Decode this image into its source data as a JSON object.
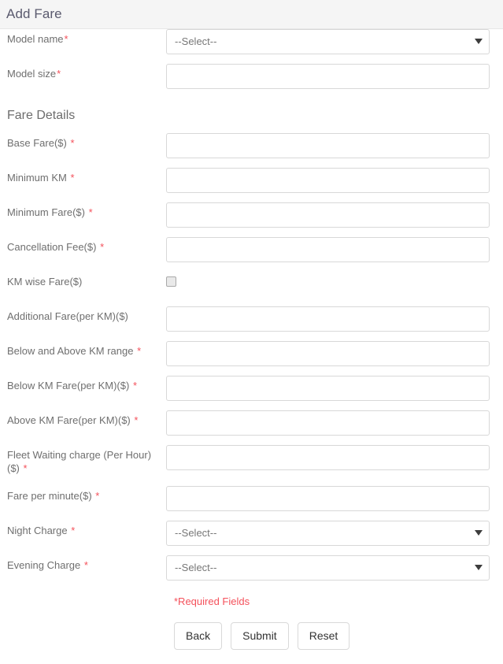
{
  "header": {
    "title": "Add Fare"
  },
  "section": {
    "fare_details_title": "Fare Details"
  },
  "fields": {
    "model_name": {
      "label": "Model name",
      "required_mark": "*",
      "type": "select",
      "value": "--Select--",
      "caret": "chevron-down-icon"
    },
    "model_size": {
      "label": "Model size",
      "required_mark": "*",
      "type": "text",
      "value": "",
      "placeholder": ""
    },
    "base_fare": {
      "label": "Base Fare($)",
      "required_mark": "*",
      "type": "text",
      "value": "",
      "placeholder": ""
    },
    "minimum_km": {
      "label": "Minimum KM",
      "required_mark": "*",
      "type": "text",
      "value": "",
      "placeholder": ""
    },
    "minimum_fare": {
      "label": "Minimum Fare($)",
      "required_mark": "*",
      "type": "text",
      "value": "",
      "placeholder": ""
    },
    "cancellation_fee": {
      "label": "Cancellation Fee($)",
      "required_mark": "*",
      "type": "text",
      "value": "",
      "placeholder": ""
    },
    "km_wise_fare": {
      "label": "KM wise Fare($)",
      "required_mark": "",
      "type": "checkbox",
      "checked": false
    },
    "additional_fare": {
      "label": "Additional Fare(per KM)($)",
      "required_mark": "",
      "type": "text",
      "value": "",
      "placeholder": ""
    },
    "below_above_km_range": {
      "label": "Below and Above KM range",
      "required_mark": "*",
      "type": "text",
      "value": "",
      "placeholder": ""
    },
    "below_km_fare": {
      "label": "Below KM Fare(per KM)($)",
      "required_mark": "*",
      "type": "text",
      "value": "",
      "placeholder": ""
    },
    "above_km_fare": {
      "label": "Above KM Fare(per KM)($)",
      "required_mark": "*",
      "type": "text",
      "value": "",
      "placeholder": ""
    },
    "fleet_waiting_charge": {
      "label": "Fleet Waiting charge (Per Hour) ($)",
      "required_mark": "*",
      "type": "text",
      "value": "",
      "placeholder": ""
    },
    "fare_per_minute": {
      "label": "Fare per minute($)",
      "required_mark": "*",
      "type": "text",
      "value": "",
      "placeholder": ""
    },
    "night_charge": {
      "label": "Night Charge",
      "required_mark": "*",
      "type": "select",
      "value": "--Select--",
      "caret": "chevron-down-icon"
    },
    "evening_charge": {
      "label": "Evening Charge",
      "required_mark": "*",
      "type": "select",
      "value": "--Select--",
      "caret": "chevron-down-icon"
    }
  },
  "notes": {
    "required_fields": "*Required Fields"
  },
  "buttons": {
    "back": "Back",
    "submit": "Submit",
    "reset": "Reset"
  },
  "colors": {
    "required_red": "#f4515b",
    "header_bg": "#f5f5f5",
    "label_gray": "#6f6f6f",
    "border_gray": "#d8d8d8"
  }
}
